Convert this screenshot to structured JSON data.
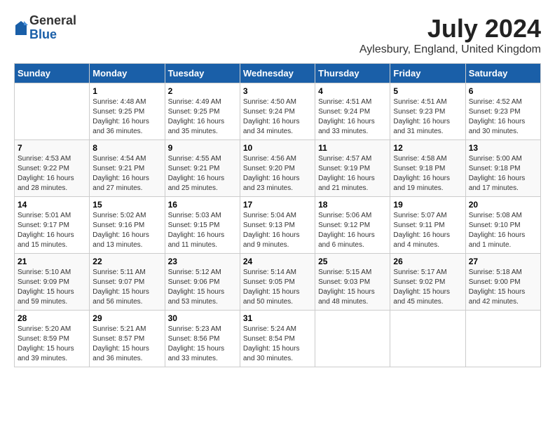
{
  "logo": {
    "general": "General",
    "blue": "Blue"
  },
  "title": {
    "month": "July 2024",
    "location": "Aylesbury, England, United Kingdom"
  },
  "weekdays": [
    "Sunday",
    "Monday",
    "Tuesday",
    "Wednesday",
    "Thursday",
    "Friday",
    "Saturday"
  ],
  "weeks": [
    [
      {
        "day": "",
        "info": ""
      },
      {
        "day": "1",
        "info": "Sunrise: 4:48 AM\nSunset: 9:25 PM\nDaylight: 16 hours\nand 36 minutes."
      },
      {
        "day": "2",
        "info": "Sunrise: 4:49 AM\nSunset: 9:25 PM\nDaylight: 16 hours\nand 35 minutes."
      },
      {
        "day": "3",
        "info": "Sunrise: 4:50 AM\nSunset: 9:24 PM\nDaylight: 16 hours\nand 34 minutes."
      },
      {
        "day": "4",
        "info": "Sunrise: 4:51 AM\nSunset: 9:24 PM\nDaylight: 16 hours\nand 33 minutes."
      },
      {
        "day": "5",
        "info": "Sunrise: 4:51 AM\nSunset: 9:23 PM\nDaylight: 16 hours\nand 31 minutes."
      },
      {
        "day": "6",
        "info": "Sunrise: 4:52 AM\nSunset: 9:23 PM\nDaylight: 16 hours\nand 30 minutes."
      }
    ],
    [
      {
        "day": "7",
        "info": "Sunrise: 4:53 AM\nSunset: 9:22 PM\nDaylight: 16 hours\nand 28 minutes."
      },
      {
        "day": "8",
        "info": "Sunrise: 4:54 AM\nSunset: 9:21 PM\nDaylight: 16 hours\nand 27 minutes."
      },
      {
        "day": "9",
        "info": "Sunrise: 4:55 AM\nSunset: 9:21 PM\nDaylight: 16 hours\nand 25 minutes."
      },
      {
        "day": "10",
        "info": "Sunrise: 4:56 AM\nSunset: 9:20 PM\nDaylight: 16 hours\nand 23 minutes."
      },
      {
        "day": "11",
        "info": "Sunrise: 4:57 AM\nSunset: 9:19 PM\nDaylight: 16 hours\nand 21 minutes."
      },
      {
        "day": "12",
        "info": "Sunrise: 4:58 AM\nSunset: 9:18 PM\nDaylight: 16 hours\nand 19 minutes."
      },
      {
        "day": "13",
        "info": "Sunrise: 5:00 AM\nSunset: 9:18 PM\nDaylight: 16 hours\nand 17 minutes."
      }
    ],
    [
      {
        "day": "14",
        "info": "Sunrise: 5:01 AM\nSunset: 9:17 PM\nDaylight: 16 hours\nand 15 minutes."
      },
      {
        "day": "15",
        "info": "Sunrise: 5:02 AM\nSunset: 9:16 PM\nDaylight: 16 hours\nand 13 minutes."
      },
      {
        "day": "16",
        "info": "Sunrise: 5:03 AM\nSunset: 9:15 PM\nDaylight: 16 hours\nand 11 minutes."
      },
      {
        "day": "17",
        "info": "Sunrise: 5:04 AM\nSunset: 9:13 PM\nDaylight: 16 hours\nand 9 minutes."
      },
      {
        "day": "18",
        "info": "Sunrise: 5:06 AM\nSunset: 9:12 PM\nDaylight: 16 hours\nand 6 minutes."
      },
      {
        "day": "19",
        "info": "Sunrise: 5:07 AM\nSunset: 9:11 PM\nDaylight: 16 hours\nand 4 minutes."
      },
      {
        "day": "20",
        "info": "Sunrise: 5:08 AM\nSunset: 9:10 PM\nDaylight: 16 hours\nand 1 minute."
      }
    ],
    [
      {
        "day": "21",
        "info": "Sunrise: 5:10 AM\nSunset: 9:09 PM\nDaylight: 15 hours\nand 59 minutes."
      },
      {
        "day": "22",
        "info": "Sunrise: 5:11 AM\nSunset: 9:07 PM\nDaylight: 15 hours\nand 56 minutes."
      },
      {
        "day": "23",
        "info": "Sunrise: 5:12 AM\nSunset: 9:06 PM\nDaylight: 15 hours\nand 53 minutes."
      },
      {
        "day": "24",
        "info": "Sunrise: 5:14 AM\nSunset: 9:05 PM\nDaylight: 15 hours\nand 50 minutes."
      },
      {
        "day": "25",
        "info": "Sunrise: 5:15 AM\nSunset: 9:03 PM\nDaylight: 15 hours\nand 48 minutes."
      },
      {
        "day": "26",
        "info": "Sunrise: 5:17 AM\nSunset: 9:02 PM\nDaylight: 15 hours\nand 45 minutes."
      },
      {
        "day": "27",
        "info": "Sunrise: 5:18 AM\nSunset: 9:00 PM\nDaylight: 15 hours\nand 42 minutes."
      }
    ],
    [
      {
        "day": "28",
        "info": "Sunrise: 5:20 AM\nSunset: 8:59 PM\nDaylight: 15 hours\nand 39 minutes."
      },
      {
        "day": "29",
        "info": "Sunrise: 5:21 AM\nSunset: 8:57 PM\nDaylight: 15 hours\nand 36 minutes."
      },
      {
        "day": "30",
        "info": "Sunrise: 5:23 AM\nSunset: 8:56 PM\nDaylight: 15 hours\nand 33 minutes."
      },
      {
        "day": "31",
        "info": "Sunrise: 5:24 AM\nSunset: 8:54 PM\nDaylight: 15 hours\nand 30 minutes."
      },
      {
        "day": "",
        "info": ""
      },
      {
        "day": "",
        "info": ""
      },
      {
        "day": "",
        "info": ""
      }
    ]
  ]
}
